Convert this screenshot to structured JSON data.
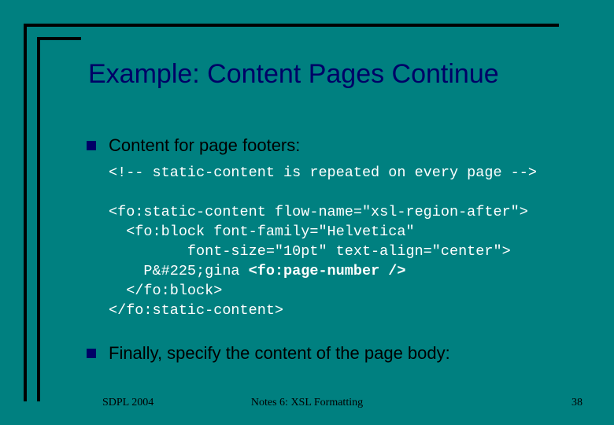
{
  "slide": {
    "title": "Example: Content Pages Continue",
    "bullets": [
      {
        "text": "Content for page footers:"
      },
      {
        "text": "Finally, specify the content of the page body:"
      }
    ],
    "code": {
      "line1": "<!-- static-content is repeated on every page -->",
      "line2": "<fo:static-content flow-name=\"xsl-region-after\">",
      "line3": "  <fo:block font-family=\"Helvetica\"",
      "line4": "         font-size=\"10pt\" text-align=\"center\">",
      "line5_a": "    P&#225;gina ",
      "line5_b": "<fo:page-number />",
      "line6": "  </fo:block>",
      "line7": "</fo:static-content>"
    }
  },
  "footer": {
    "left": "SDPL 2004",
    "center": "Notes 6: XSL Formatting",
    "right": "38"
  },
  "colors": {
    "background": "#008080",
    "title": "#000066",
    "code": "#ffffff"
  }
}
